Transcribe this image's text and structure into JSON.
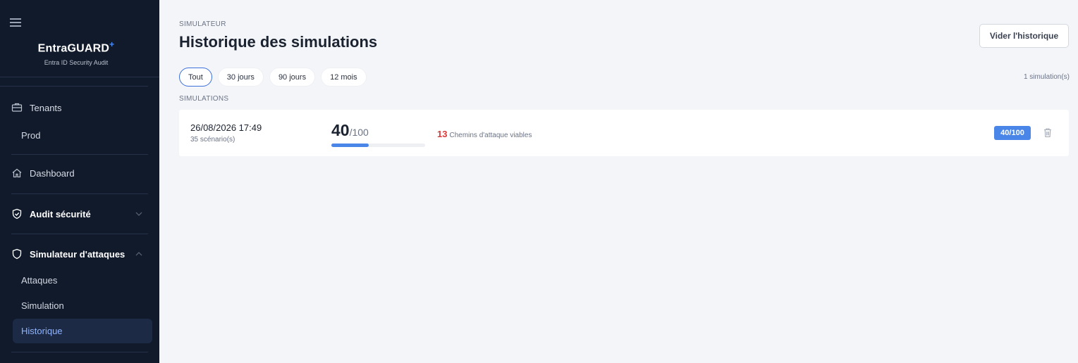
{
  "sidebar": {
    "brand_title": "EntraGUARD",
    "brand_plus": "+",
    "brand_subtitle": "Entra ID Security Audit",
    "items": {
      "tenants": "Tenants",
      "prod": "Prod",
      "dashboard": "Dashboard",
      "audit": "Audit sécurité",
      "simulator": "Simulateur d'attaques",
      "attaques": "Attaques",
      "simulation": "Simulation",
      "historique": "Historique"
    }
  },
  "header": {
    "eyebrow": "SIMULATEUR",
    "title": "Historique des simulations",
    "clear_button": "Vider l'historique"
  },
  "filters": [
    {
      "label": "Tout",
      "active": true
    },
    {
      "label": "30 jours",
      "active": false
    },
    {
      "label": "90 jours",
      "active": false
    },
    {
      "label": "12 mois",
      "active": false
    }
  ],
  "count_text": "1 simulation(s)",
  "section_label": "SIMULATIONS",
  "simulations": [
    {
      "date": "26/08/2026 17:49",
      "scenarios": "35 scénario(s)",
      "score": "40",
      "score_max": "/100",
      "score_fraction": 0.4,
      "paths_count": "13",
      "paths_label": "Chemins d'attaque viables",
      "badge": "40/100"
    }
  ],
  "colors": {
    "sidebar_bg": "#111a2b",
    "accent": "#4a86e8",
    "danger": "#d93a3a",
    "active_text": "#8fb4ff"
  }
}
